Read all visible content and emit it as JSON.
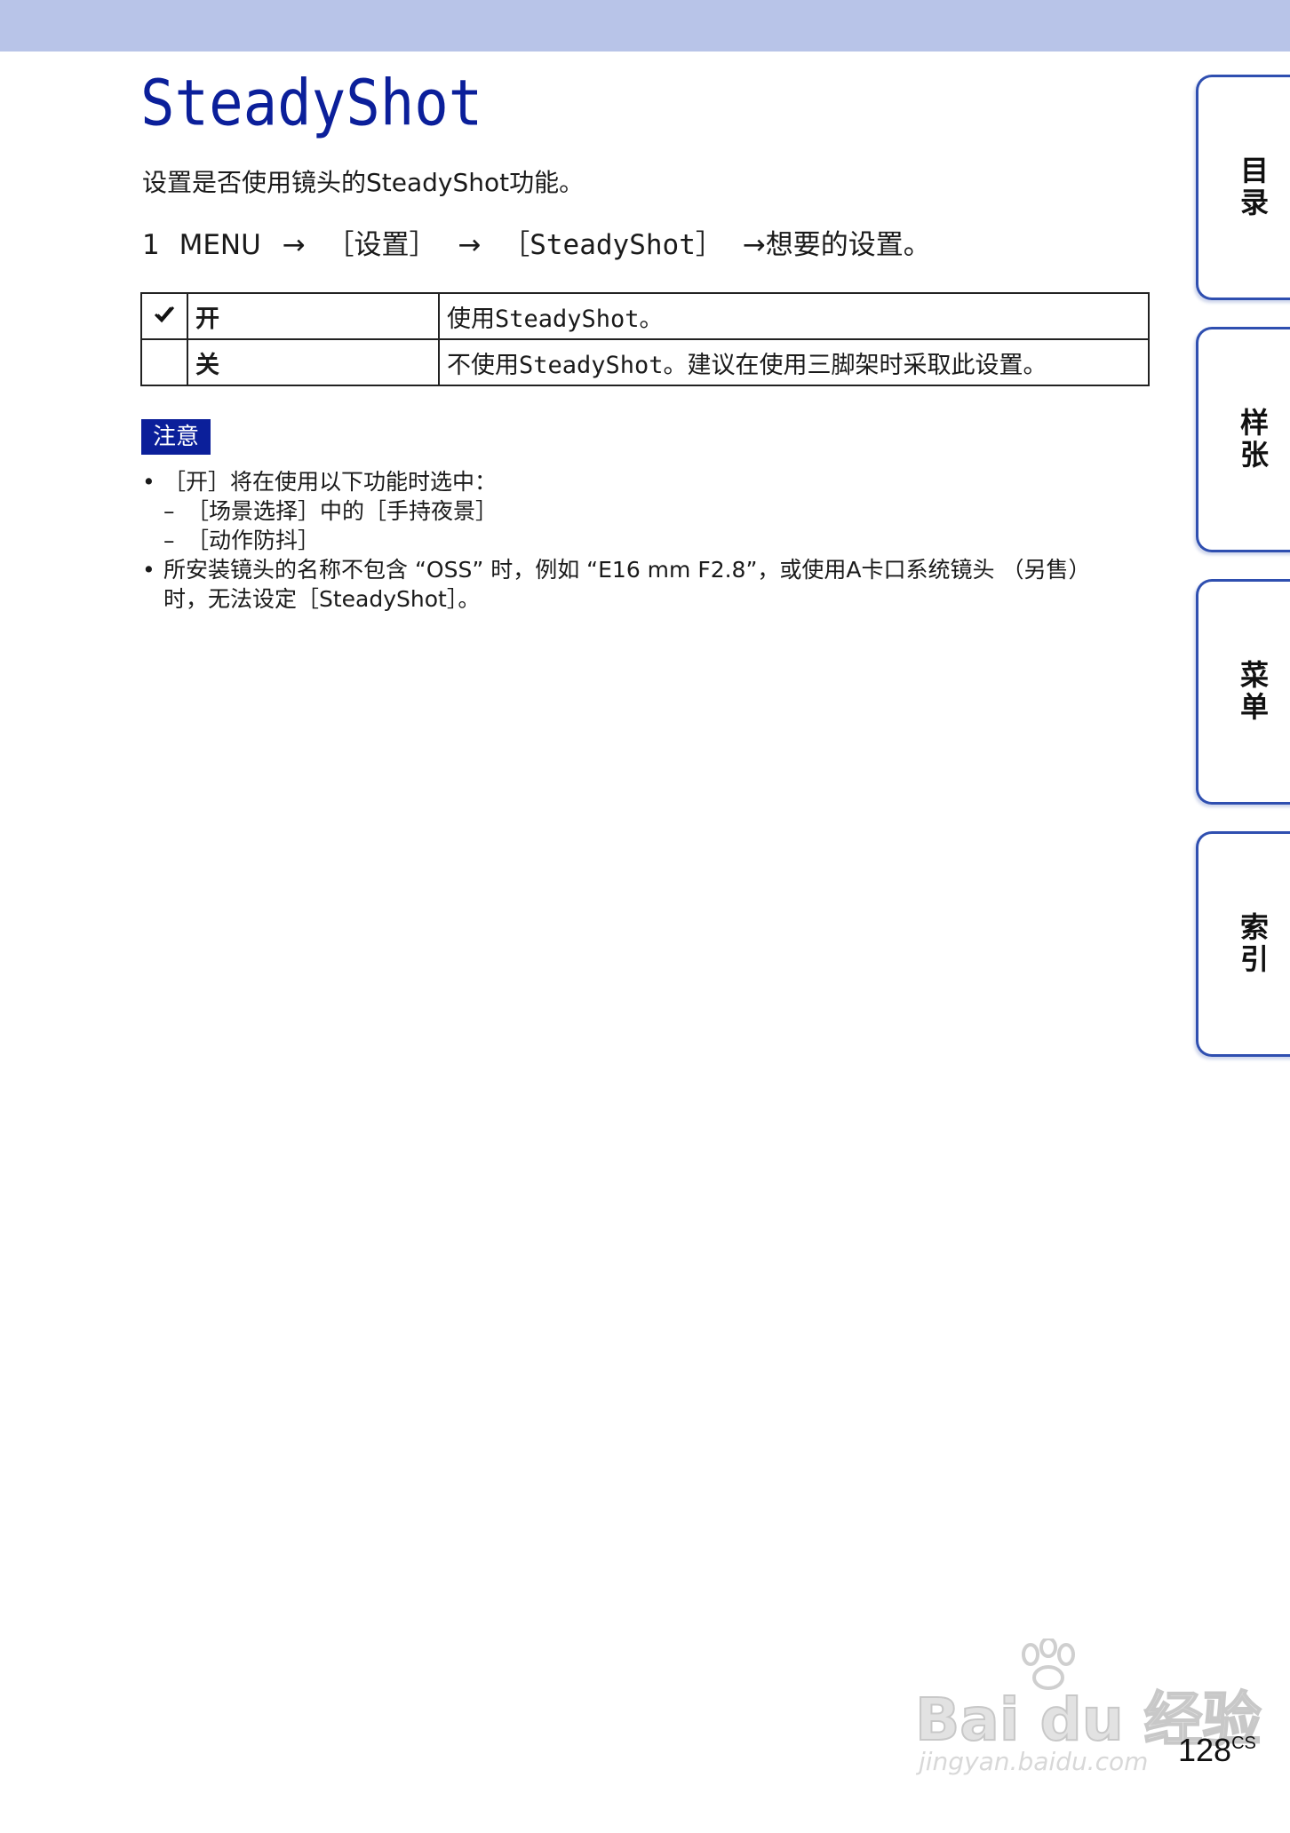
{
  "page": {
    "title": "SteadyShot",
    "intro": "设置是否使用镜头的SteadyShot功能。",
    "page_number": "128",
    "page_suffix": "CS"
  },
  "step": {
    "number": "1",
    "menu": "MENU",
    "arrow": "→",
    "setup": "［设置］",
    "item": "［SteadyShot］",
    "end": "→想要的设置。"
  },
  "table": {
    "rows": [
      {
        "checked": true,
        "option": "开",
        "description": "使用SteadyShot。"
      },
      {
        "checked": false,
        "option": "关",
        "description": "不使用SteadyShot。建议在使用三脚架时采取此设置。"
      }
    ]
  },
  "notes": {
    "badge": "注意",
    "items": [
      {
        "type": "bullet",
        "text": "［开］将在使用以下功能时选中："
      },
      {
        "type": "dash",
        "text": "［场景选择］中的［手持夜景］"
      },
      {
        "type": "dash",
        "text": "［动作防抖］"
      },
      {
        "type": "bullet",
        "text": "所安装镜头的名称不包含 “OSS” 时，例如 “E16 mm F2.8”，或使用A卡口系统镜头 （另售）"
      },
      {
        "type": "continuation",
        "text": "时，无法设定［SteadyShot］。"
      }
    ]
  },
  "side_tabs": [
    {
      "label": "目录"
    },
    {
      "label": "样张"
    },
    {
      "label": "菜单"
    },
    {
      "label": "索引"
    }
  ],
  "watermark": {
    "brand": "Bai du 经验",
    "url": "jingyan.baidu.com"
  },
  "colors": {
    "accent": "#0b1f9a",
    "band": "#b8c4e8",
    "tab_border": "#2f4fb0"
  }
}
